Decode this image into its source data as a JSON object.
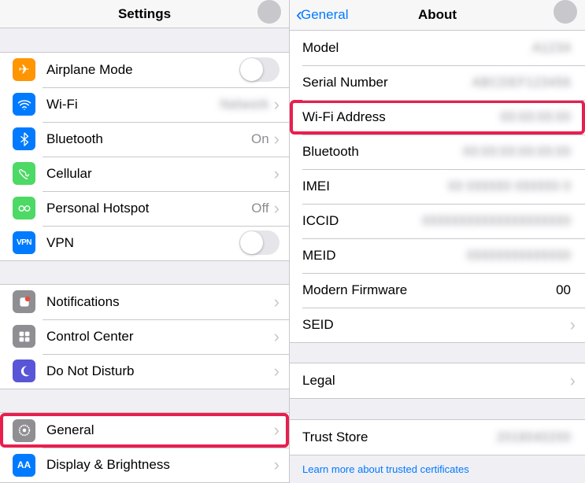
{
  "left": {
    "title": "Settings",
    "group1": [
      {
        "label": "Airplane Mode",
        "type": "toggle"
      },
      {
        "label": "Wi-Fi",
        "value": "",
        "chevron": true
      },
      {
        "label": "Bluetooth",
        "value": "On",
        "chevron": true
      },
      {
        "label": "Cellular",
        "chevron": true
      },
      {
        "label": "Personal Hotspot",
        "value": "Off",
        "chevron": true
      },
      {
        "label": "VPN",
        "type": "toggle"
      }
    ],
    "group2": [
      {
        "label": "Notifications",
        "chevron": true
      },
      {
        "label": "Control Center",
        "chevron": true
      },
      {
        "label": "Do Not Disturb",
        "chevron": true
      }
    ],
    "group3": [
      {
        "label": "General",
        "chevron": true
      },
      {
        "label": "Display & Brightness",
        "chevron": true
      }
    ]
  },
  "right": {
    "back": "General",
    "title": "About",
    "rows": [
      {
        "label": "Model",
        "value": ""
      },
      {
        "label": "Serial Number",
        "value": ""
      },
      {
        "label": "Wi-Fi Address",
        "value": "",
        "highlight": true
      },
      {
        "label": "Bluetooth",
        "value": ""
      },
      {
        "label": "IMEI",
        "value": ""
      },
      {
        "label": "ICCID",
        "value": ""
      },
      {
        "label": "MEID",
        "value": ""
      },
      {
        "label": "Modern Firmware",
        "value": "00"
      }
    ],
    "seid": "SEID",
    "legal": "Legal",
    "trust": "Trust Store",
    "footer": "Learn more about trusted certificates"
  }
}
